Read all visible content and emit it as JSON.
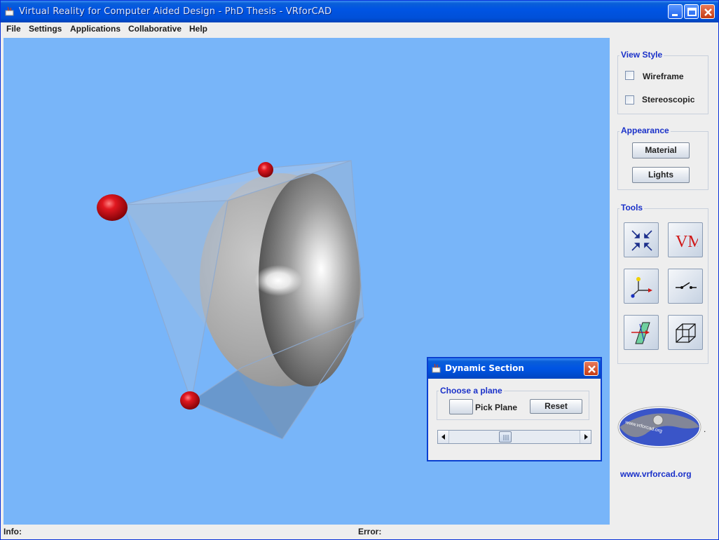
{
  "window": {
    "title": "Virtual Reality for Computer Aided Design - PhD Thesis  - VRforCAD"
  },
  "menu": [
    "File",
    "Settings",
    "Applications",
    "Collaborative",
    "Help"
  ],
  "panel": {
    "view_style": {
      "title": "View Style",
      "wireframe": "Wireframe",
      "stereoscopic": "Stereoscopic",
      "wireframe_checked": false,
      "stereoscopic_checked": false
    },
    "appearance": {
      "title": "Appearance",
      "material": "Material",
      "lights": "Lights"
    },
    "tools": {
      "title": "Tools",
      "items": [
        "zoom-fit-icon",
        "vm-icon",
        "axes-icon",
        "switch-icon",
        "section-plane-icon",
        "box-icon"
      ],
      "vm_text": "VM"
    },
    "site": "www.vrforcad.org",
    "logo_text": "www.vrforcad.org",
    "dot": "."
  },
  "dialog": {
    "title": "Dynamic Section",
    "group": "Choose a plane",
    "pick_plane": "Pick Plane",
    "reset": "Reset",
    "slider_value": 0.42
  },
  "status": {
    "info": "Info:",
    "error": "Error:"
  },
  "colors": {
    "viewport_bg": "#78b5f9",
    "accent": "#1a31c9",
    "sphere_red": "#d0141a",
    "titlebar": "#0054e3"
  }
}
